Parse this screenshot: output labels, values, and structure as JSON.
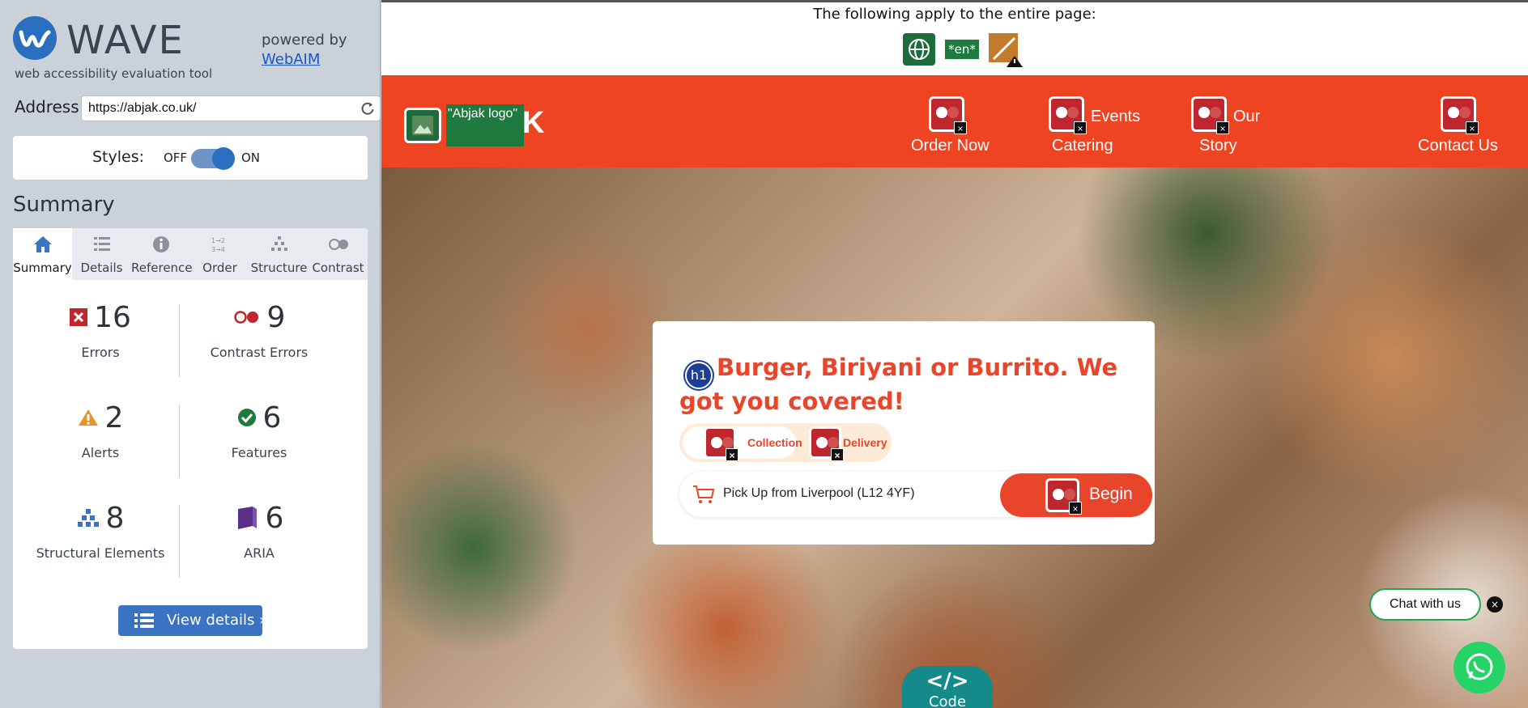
{
  "wave": {
    "title": "WAVE",
    "subtitle": "web accessibility evaluation tool",
    "powered_by": "powered by",
    "webaim_link": "WebAIM",
    "address_label": "Address:",
    "address_value": "https://abjak.co.uk/",
    "styles_label": "Styles:",
    "styles_off": "OFF",
    "styles_on": "ON",
    "styles_enabled": true,
    "summary_heading": "Summary",
    "tabs": [
      {
        "label": "Summary",
        "icon": "home-icon",
        "active": true
      },
      {
        "label": "Details",
        "icon": "list-icon",
        "active": false
      },
      {
        "label": "Reference",
        "icon": "info-icon",
        "active": false
      },
      {
        "label": "Order",
        "icon": "order-icon",
        "active": false
      },
      {
        "label": "Structure",
        "icon": "structure-icon",
        "active": false
      },
      {
        "label": "Contrast",
        "icon": "contrast-icon",
        "active": false
      }
    ],
    "stats": {
      "errors": {
        "count": "16",
        "label": "Errors",
        "color": "#c0262d"
      },
      "contrast": {
        "count": "9",
        "label": "Contrast Errors",
        "color": "#c0262d"
      },
      "alerts": {
        "count": "2",
        "label": "Alerts",
        "color": "#e8922a"
      },
      "features": {
        "count": "6",
        "label": "Features",
        "color": "#1e7a3e"
      },
      "structural": {
        "count": "8",
        "label": "Structural Elements",
        "color": "#3a73c2"
      },
      "aria": {
        "count": "6",
        "label": "ARIA",
        "color": "#5a2e8a"
      }
    },
    "view_details": "View details ›"
  },
  "page": {
    "notice": "The following apply to the entire page:",
    "lang_badge": "*en*",
    "logo_alt": "\"Abjak logo\"",
    "logo_tail": "K",
    "nav": [
      {
        "top": "",
        "label": "Order Now"
      },
      {
        "top": "Events",
        "label": "Catering"
      },
      {
        "top": "Our",
        "label": "Story"
      },
      {
        "top": "",
        "label": "Contact Us"
      }
    ],
    "h1_badge": "h1",
    "hero_title": "Burger, Biriyani or Burrito. We got you covered!",
    "options": [
      "Collection",
      "Delivery"
    ],
    "pickup_text": "Pick Up from Liverpool (L12 4YF)",
    "begin_label": "Begin",
    "chat_label": "Chat with us",
    "chat_close": "×",
    "code_glyph": "</>",
    "code_label": "Code",
    "brand_color": "#ee4422"
  }
}
